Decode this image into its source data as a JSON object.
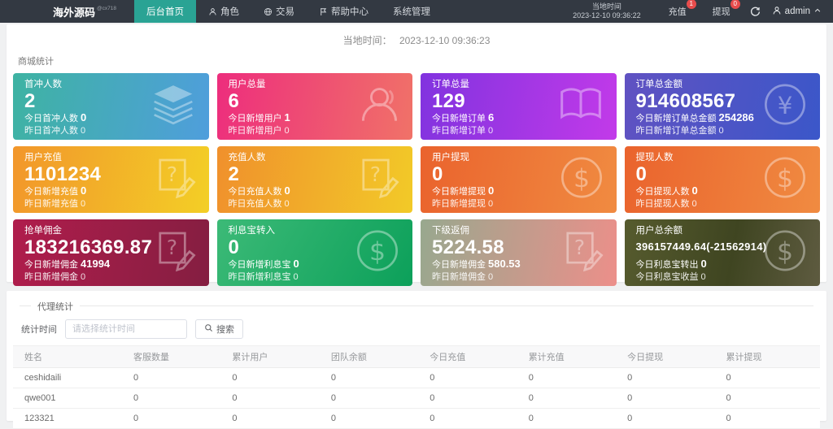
{
  "navbar": {
    "logo": "海外源码",
    "logo_sup": "@cx718",
    "menu": [
      {
        "label": "后台首页"
      },
      {
        "label": "角色"
      },
      {
        "label": "交易"
      },
      {
        "label": "帮助中心"
      },
      {
        "label": "系统管理"
      }
    ],
    "local_time_label": "当地时间",
    "local_time_value": "2023-12-10 09:36:22",
    "recharge": {
      "label": "充值",
      "badge": "1"
    },
    "withdraw": {
      "label": "提现",
      "badge": "0"
    },
    "username": "admin"
  },
  "header_time": {
    "label": "当地时间：",
    "value": "2023-12-10 09:36:23"
  },
  "stats": {
    "section_title": "商城统计",
    "cards": [
      {
        "title": "首冲人数",
        "value": "2",
        "line1_label": "今日首冲人数",
        "line1_value": "0",
        "line2_label": "昨日首冲人数",
        "line2_value": "0",
        "icon": "layers-icon",
        "gradient": "linear-gradient(100deg,#3eb3a2,#4f9edc)"
      },
      {
        "title": "用户总量",
        "value": "6",
        "line1_label": "今日新增用户",
        "line1_value": "1",
        "line2_label": "昨日新增用户",
        "line2_value": "0",
        "icon": "users-icon",
        "gradient": "linear-gradient(100deg,#ed2d7d,#f07268)"
      },
      {
        "title": "订单总量",
        "value": "129",
        "line1_label": "今日新增订单",
        "line1_value": "6",
        "line2_label": "昨日新增订单",
        "line2_value": "0",
        "icon": "open-book-icon",
        "gradient": "linear-gradient(100deg,#8133df,#c23ae9)"
      },
      {
        "title": "订单总金额",
        "value": "914608567",
        "line1_label": "今日新增订单总金额",
        "line1_value": "254286",
        "line2_label": "昨日新增订单总金额",
        "line2_value": "0",
        "icon": "yen-circle-icon",
        "gradient": "linear-gradient(100deg,#6052c2,#3b57c9)"
      },
      {
        "title": "用户充值",
        "value": "1101234",
        "line1_label": "今日新增充值",
        "line1_value": "0",
        "line2_label": "昨日新增充值",
        "line2_value": "0",
        "icon": "doc-edit-icon",
        "gradient": "linear-gradient(100deg,#f2962b,#f3cf26)"
      },
      {
        "title": "充值人数",
        "value": "2",
        "line1_label": "今日充值人数",
        "line1_value": "0",
        "line2_label": "昨日充值人数",
        "line2_value": "0",
        "icon": "doc-edit-icon",
        "gradient": "linear-gradient(100deg,#f0902c,#f2ca28)"
      },
      {
        "title": "用户提现",
        "value": "0",
        "line1_label": "今日新增提现",
        "line1_value": "0",
        "line2_label": "昨日新增提现",
        "line2_value": "0",
        "icon": "dollar-circle-icon",
        "gradient": "linear-gradient(100deg,#ea632d,#f08b41)"
      },
      {
        "title": "提现人数",
        "value": "0",
        "line1_label": "今日提现人数",
        "line1_value": "0",
        "line2_label": "昨日提现人数",
        "line2_value": "0",
        "icon": "dollar-circle-icon",
        "gradient": "linear-gradient(100deg,#ea632d,#f08b41)"
      },
      {
        "title": "抢单佣金",
        "value": "183216369.87",
        "line1_label": "今日新增佣金",
        "line1_value": "41994",
        "line2_label": "昨日新增佣金",
        "line2_value": "0",
        "icon": "doc-edit-icon",
        "gradient": "linear-gradient(100deg,#b01d4c,#841e41)"
      },
      {
        "title": "利息宝转入",
        "value": "0",
        "line1_label": "今日新增利息宝",
        "line1_value": "0",
        "line2_label": "昨日新增利息宝",
        "line2_value": "0",
        "icon": "dollar-circle-icon",
        "gradient": "linear-gradient(120deg,#3cba77,#0ca05a)"
      },
      {
        "title": "下级返佣",
        "value": "5224.58",
        "line1_label": "今日新增佣金",
        "line1_value": "580.53",
        "line2_label": "昨日新增佣金",
        "line2_value": "0",
        "icon": "doc-edit-icon",
        "gradient": "linear-gradient(100deg,#98a88e,#ec8f8a)"
      },
      {
        "title": "用户总余额",
        "value": "396157449.64(-21562914)",
        "line1_label": "今日利息宝转出",
        "line1_value": "0",
        "line2_label": "今日利息宝收益",
        "line2_value": "0",
        "icon": "dollar-circle-icon",
        "gradient": "linear-gradient(100deg,#565b2e,#3f4521 55%,#5e5b40)"
      }
    ]
  },
  "agent": {
    "legend": "代理统计",
    "time_label": "统计时间",
    "time_placeholder": "请选择统计时间",
    "search_label": "搜索"
  },
  "table": {
    "headers": [
      "姓名",
      "客服数量",
      "累计用户",
      "团队余额",
      "今日充值",
      "累计充值",
      "今日提现",
      "累计提现"
    ],
    "rows": [
      [
        "ceshidaili",
        "0",
        "0",
        "0",
        "0",
        "0",
        "0",
        "0"
      ],
      [
        "qwe001",
        "0",
        "0",
        "0",
        "0",
        "0",
        "0",
        "0"
      ],
      [
        "123321",
        "0",
        "0",
        "0",
        "0",
        "0",
        "0",
        "0"
      ]
    ]
  },
  "colors": {
    "navbar": "#333942",
    "accent": "#2aa394",
    "badge": "#e74c4c"
  }
}
